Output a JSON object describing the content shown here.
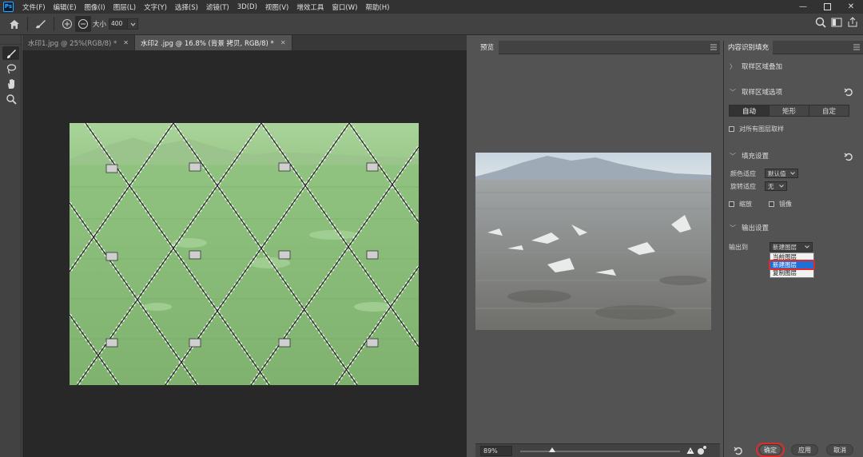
{
  "menu": [
    "文件(F)",
    "编辑(E)",
    "图像(I)",
    "图层(L)",
    "文字(Y)",
    "选择(S)",
    "滤镜(T)",
    "3D(D)",
    "视图(V)",
    "增效工具",
    "窗口(W)",
    "帮助(H)"
  ],
  "options": {
    "size_label": "大小",
    "size_value": "400"
  },
  "doc_tabs": [
    {
      "label": "水印1.jpg @ 25%(RGB/8) *"
    },
    {
      "label": "水印2 .jpg @ 16.8% (背景 拷贝, RGB/8) *"
    }
  ],
  "preview": {
    "tab": "预览",
    "zoom": "89%"
  },
  "panel": {
    "tab": "内容识别填充",
    "sampling_overlay": "取样区域叠加",
    "sampling_options": "取样区域选项",
    "sampling_modes": [
      "自动",
      "矩形",
      "自定"
    ],
    "sample_all_layers": "对所有图层取样",
    "fill_settings": "填充设置",
    "color_adapt_label": "颜色适应",
    "color_adapt_value": "默认值",
    "rotate_adapt_label": "旋转适应",
    "rotate_adapt_value": "无",
    "scale_label": "缩放",
    "mirror_label": "镜像",
    "output_settings": "输出设置",
    "output_to_label": "输出到",
    "output_to_value": "新建图层",
    "output_options": [
      "当前图层",
      "新建图层",
      "复制图层"
    ],
    "ok": "确定",
    "apply": "应用",
    "cancel": "取消"
  },
  "colors": {
    "accent_red": "#e02b2b",
    "selection_blue": "#1f6fd6",
    "overlay_green": "#9fd08e"
  }
}
